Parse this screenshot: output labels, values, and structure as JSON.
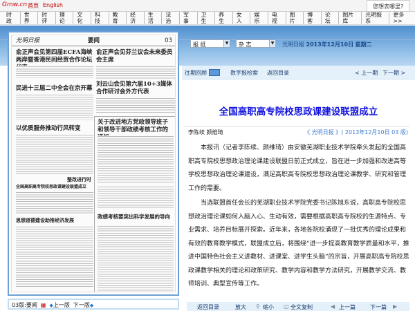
{
  "header": {
    "logo": "Gmw.cn",
    "links": [
      "首页",
      "English"
    ],
    "search_placeholder": "您想去哪里?"
  },
  "nav": [
    "时政",
    "世界",
    "时评",
    "理论",
    "文化",
    "科技",
    "教育",
    "经济",
    "生活",
    "法治",
    "军事",
    "卫生",
    "养生",
    "女人",
    "娱乐",
    "电视",
    "图片",
    "博客",
    "论坛",
    "图片库",
    "光明报系",
    "更多>>"
  ],
  "paper": {
    "masthead": "光明日报",
    "section": "要闻",
    "page_no": "03",
    "headlines": [
      "俞正声会见第四届ECFA海峡两岸暨香港民间经贸合作论坛代表",
      "俞正声会见芬兰议会未来委员会主席",
      "刘云山会见第六届10+3媒体合作研讨会外方代表",
      "民进十三届二中全会在京开幕",
      "关于改进地方党政领导班子和领导干部政绩考核工作的通知",
      "以优质服务推动行风转变",
      "全国高职高专院校思政课建设联盟成立",
      "整改进行时",
      "思想道德建设助推经济发展",
      "政绩考核要突出科学发展的导向"
    ],
    "footer": {
      "page_label": "03版:要闻",
      "prev": "上一版",
      "next": "下一版"
    }
  },
  "selectors": {
    "paper": "报 纸",
    "magazine": "杂 志"
  },
  "date": {
    "paper": "光明日报",
    "date": "2013年12月10日",
    "weekday": "星期二"
  },
  "toolbar": {
    "archive": "往期回顾",
    "search": "数字报检索",
    "back": "返回目录",
    "prev_issue": "< 上一期",
    "next_issue": "下一期 >"
  },
  "article": {
    "title": "全国高职高专院校思政课建设联盟成立",
    "authors": "李陈续 颜维琦",
    "source_paper": "《 光明日报 》",
    "source_date": "( 2013年12月10日",
    "source_page": "03 版)",
    "paragraphs": [
      "本报讯（记者李陈续、颜维琦）由安徽芜湖职业技术学院牵头发起的全国高职高专院校思想政治理论课建设联盟日前正式成立，旨在进一步加强和改进高等学校思想政治理论课建设，满足高职高专院校思想政治理论课教学、研究和管理工作的需要。",
      "当选联盟首任会长的芜湖职业技术学院党委书记陈旭东说，高职高专院校思想政治理论课如何入脑入心、生动有效，需要根据高职高专院校的生源特点、专业需求、培养目标展开探索。近年来，各地各院校涌现了一批优秀的理论成果和有效的教育教学模式，联盟成立后，将围绕“进一步提高教育教学质量和水平，推进中国特色社会主义进教材、进课堂、进学生头脑”的宗旨，开展高职高专院校思政课教学相关的理论和政策研究、教学内容和教学方法研究，开展教学交流、教师培训、典型宣传等工作。"
    ]
  },
  "bottom_toolbar": {
    "back": "返回目录",
    "zoom_in": "放大",
    "zoom_out": "缩小",
    "copy": "全文复制",
    "prev": "上一篇",
    "next": "下一篇"
  }
}
